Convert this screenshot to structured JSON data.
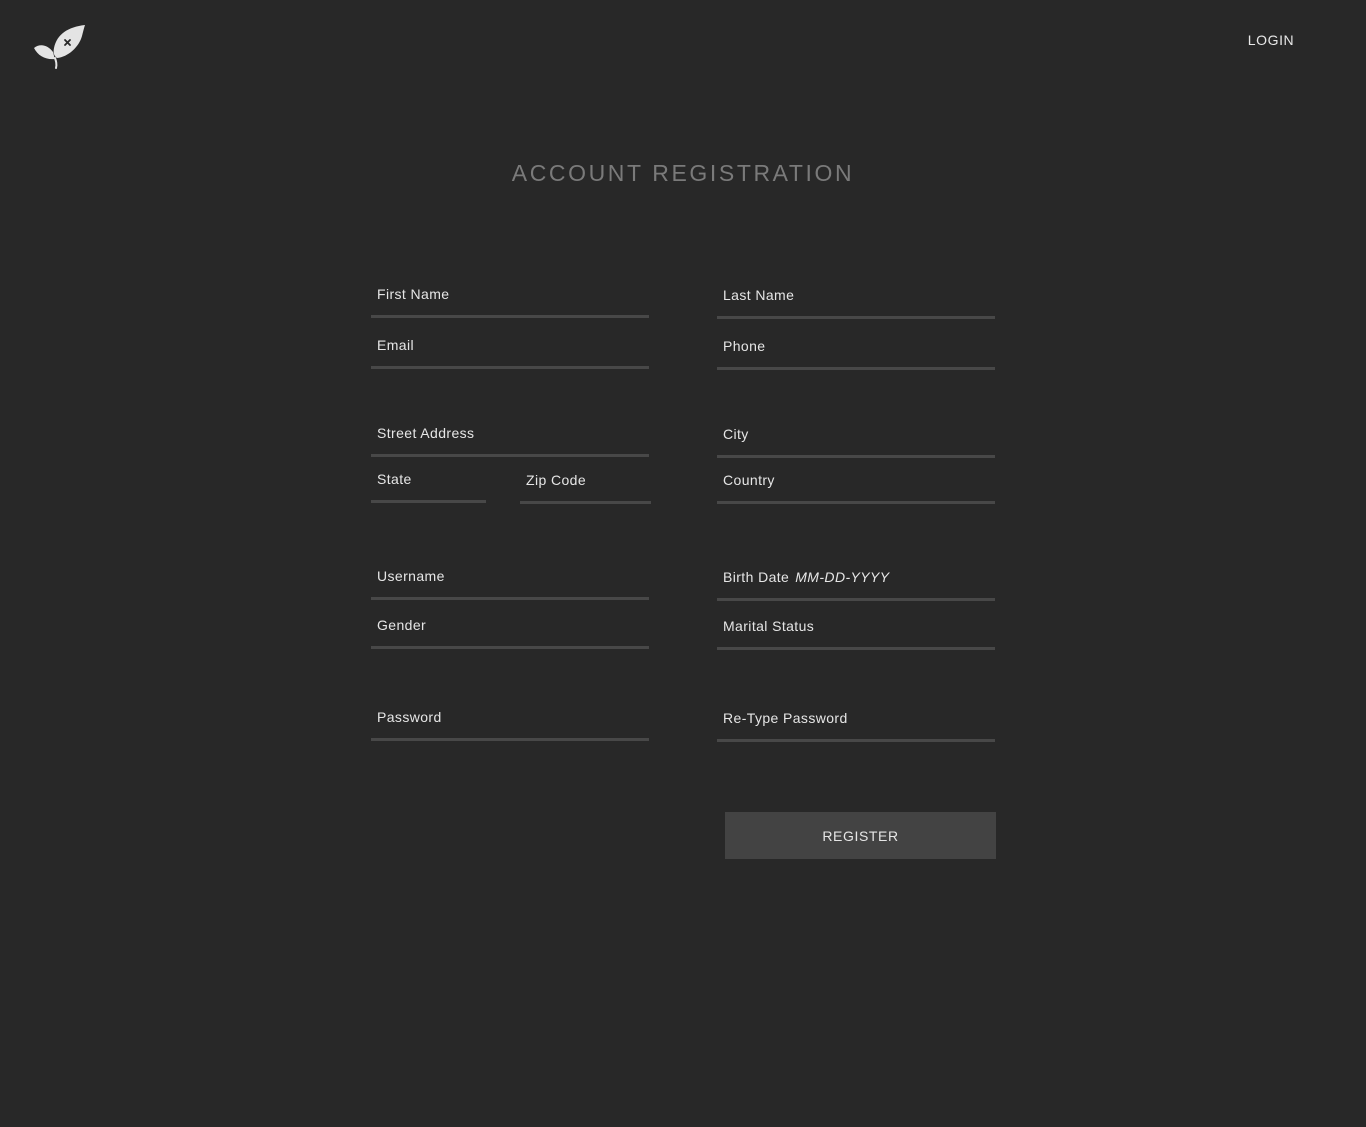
{
  "header": {
    "logo_icon": "leaf-logo-icon",
    "login_label": "LOGIN"
  },
  "page_title": "ACCOUNT REGISTRATION",
  "form": {
    "first_name": "First Name",
    "last_name": "Last Name",
    "email": "Email",
    "phone": "Phone",
    "street_address": "Street Address",
    "city": "City",
    "state": "State",
    "zip_code": "Zip Code",
    "country": "Country",
    "username": "Username",
    "birth_date": "Birth Date",
    "birth_date_format": "MM-DD-YYYY",
    "gender": "Gender",
    "marital_status": "Marital Status",
    "password": "Password",
    "retype_password": "Re-Type Password",
    "register_label": "REGISTER"
  },
  "colors": {
    "background": "#282828",
    "title": "#7a7a7a",
    "text": "#e6e6e6",
    "underline": "#484848",
    "button": "#434343"
  }
}
